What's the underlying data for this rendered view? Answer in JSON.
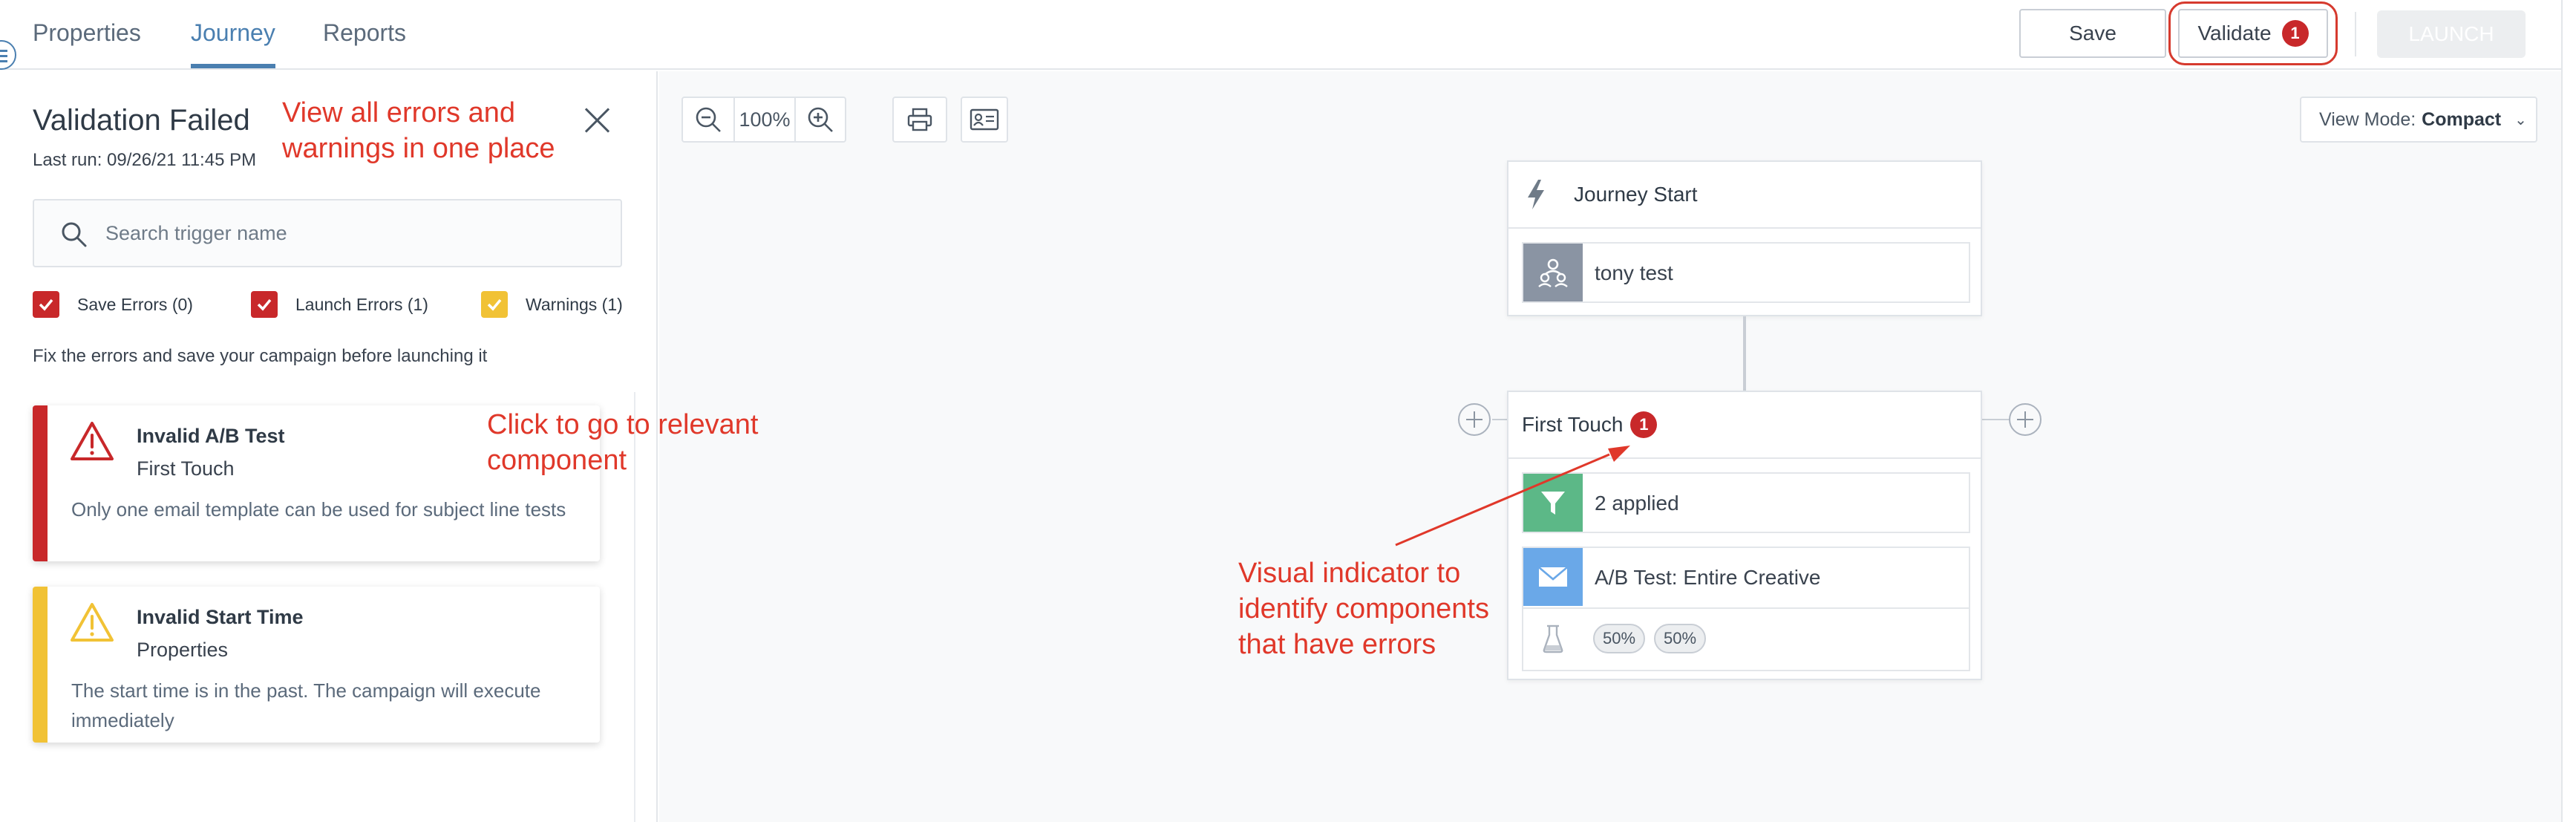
{
  "tabs": [
    {
      "label": "Properties",
      "active": false
    },
    {
      "label": "Journey",
      "active": true
    },
    {
      "label": "Reports",
      "active": false
    }
  ],
  "actions": {
    "save_label": "Save",
    "validate_label": "Validate",
    "validate_badge": "1",
    "launch_label": "LAUNCH"
  },
  "validation_panel": {
    "title": "Validation Failed",
    "last_run": "Last run: 09/26/21 11:45 PM",
    "search_placeholder": "Search trigger name",
    "filters": [
      {
        "label": "Save Errors (0)",
        "checked": true,
        "color": "#c8282a"
      },
      {
        "label": "Launch Errors (1)",
        "checked": true,
        "color": "#c8282a"
      },
      {
        "label": "Warnings (1)",
        "checked": true,
        "color": "#f1c235"
      }
    ],
    "hint": "Fix the errors and save your campaign before launching it",
    "issues": [
      {
        "severity": "error",
        "color": "#c8282a",
        "title": "Invalid A/B Test",
        "component": "First Touch",
        "message": "Only one email template can be used for subject line tests"
      },
      {
        "severity": "warning",
        "color": "#f1c235",
        "title": "Invalid Start Time",
        "component": "Properties",
        "message": "The start time is in the past. The campaign will execute immediately"
      }
    ]
  },
  "canvas_toolbar": {
    "zoom_level": "100%",
    "view_mode_label": "View Mode:",
    "view_mode_value": "Compact"
  },
  "journey": {
    "start_node": {
      "title": "Journey Start",
      "audience": "tony test"
    },
    "touch_node": {
      "title": "First Touch",
      "error_badge": "1",
      "filter_label": "2 applied",
      "email_label": "A/B Test: Entire Creative",
      "splits": [
        "50%",
        "50%"
      ]
    }
  },
  "annotations": {
    "errors_callout": "View all errors and warnings in one place",
    "click_callout": "Click to go to relevant component",
    "indicator_callout": "Visual indicator to identify components that have errors"
  },
  "colors": {
    "accent": "#4a7fb0",
    "error": "#c8282a",
    "warning": "#f1c235",
    "annotation": "#e0382a",
    "filter_icon_bg": "#5cb887",
    "email_icon_bg": "#6aa8e8",
    "audience_icon_bg": "#8a94a3"
  }
}
